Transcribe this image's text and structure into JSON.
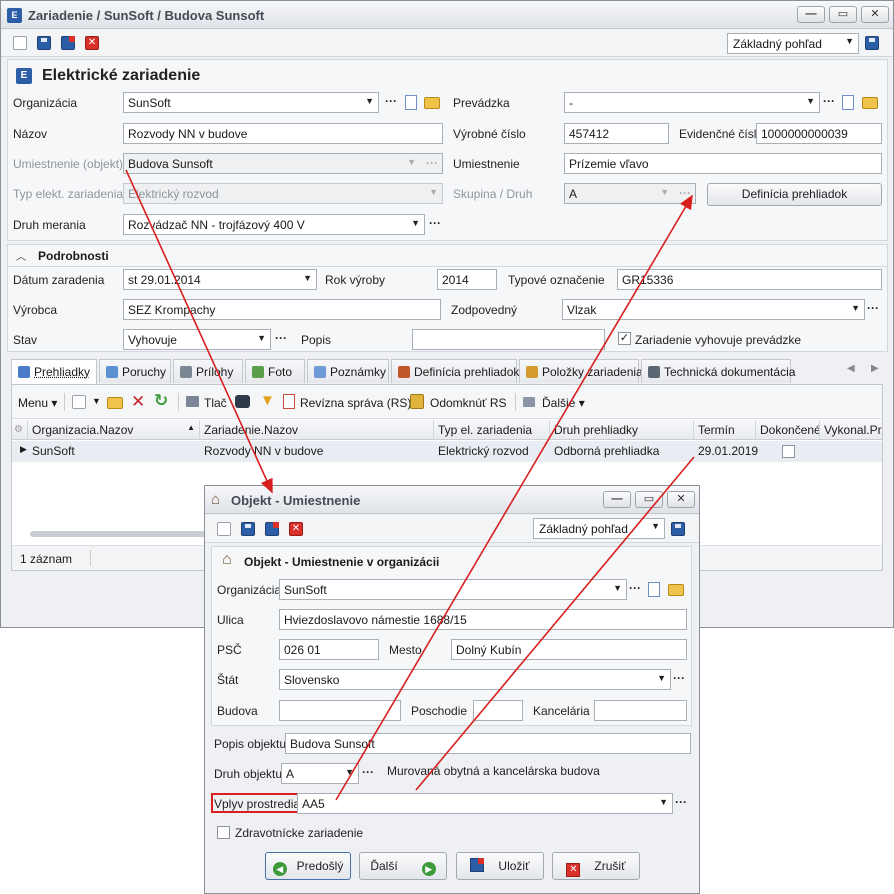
{
  "main_window": {
    "title": "Zariadenie / SunSoft / Budova Sunsoft",
    "view_select": "Základný pohľad",
    "header": "Elektrické zariadenie",
    "fields": {
      "organizacia_label": "Organizácia",
      "organizacia_value": "SunSoft",
      "prevadzka_label": "Prevádzka",
      "prevadzka_value": "-",
      "nazov_label": "Názov",
      "nazov_value": "Rozvody NN v budove",
      "vyrobne_cislo_label": "Výrobné číslo",
      "vyrobne_cislo_value": "457412",
      "evidencne_cislo_label": "Evidenčné číslo",
      "evidencne_cislo_value": "1000000000039",
      "umiestnenie_objekt_label": "Umiestnenie (objekt)",
      "umiestnenie_objekt_value": "Budova Sunsoft",
      "umiestnenie_label": "Umiestnenie",
      "umiestnenie_value": "Prízemie vľavo",
      "typ_label": "Typ elekt. zariadenia",
      "typ_value": "Elektrický rozvod",
      "skupina_label": "Skupina / Druh",
      "skupina_value": "A",
      "definicia_button": "Definícia prehliadok",
      "druh_merania_label": "Druh merania",
      "druh_merania_value": "Rozvádzač NN - trojfázový 400 V"
    },
    "details": {
      "section_title": "Podrobnosti",
      "datum_label": "Dátum zaradenia",
      "datum_value": "st 29.01.2014",
      "rok_label": "Rok výroby",
      "rok_value": "2014",
      "typove_label": "Typové označenie",
      "typove_value": "GR15336",
      "vyrobca_label": "Výrobca",
      "vyrobca_value": "SEZ Krompachy",
      "zodpovedny_label": "Zodpovedný",
      "zodpovedny_value": "Vlzak",
      "stav_label": "Stav",
      "stav_value": "Vyhovuje",
      "popis_label": "Popis",
      "popis_value": "",
      "vyhovuje_checkbox": "Zariadenie vyhovuje prevádzke"
    },
    "tabs": [
      {
        "label": "Prehliadky",
        "color": "#4a7bc8"
      },
      {
        "label": "Poruchy",
        "color": "#5a8fd1"
      },
      {
        "label": "Prílohy",
        "color": "#7d8694"
      },
      {
        "label": "Foto",
        "color": "#5aa04a"
      },
      {
        "label": "Poznámky",
        "color": "#6f9bd6"
      },
      {
        "label": "Definícia prehliadok",
        "color": "#c2562b"
      },
      {
        "label": "Položky zariadenia",
        "color": "#d49a2d"
      },
      {
        "label": "Technická dokumentácia",
        "color": "#5c6774"
      }
    ],
    "grid_toolbar": {
      "menu": "Menu",
      "tlac": "Tlač",
      "revizna": "Revízna správa (RS)",
      "odomknut": "Odomknúť RS",
      "dalsie": "Ďalšie"
    },
    "grid": {
      "columns": [
        "Organizacia.Nazov",
        "Zariadenie.Nazov",
        "Typ el. zariadenia",
        "Druh prehliadky",
        "Termín",
        "Dokončené",
        "Vykonal.Prie"
      ],
      "rows": [
        {
          "organizacia": "SunSoft",
          "zariadenie": "Rozvody NN v budove",
          "typ": "Elektrický rozvod",
          "druh": "Odborná prehliadka",
          "termin": "29.01.2019",
          "dokoncene": false
        }
      ],
      "status": "1 záznam"
    }
  },
  "dialog": {
    "title": "Objekt - Umiestnenie",
    "view_select": "Základný pohľad",
    "header": "Objekt - Umiestnenie v organizácii",
    "organizacia_label": "Organizácia",
    "organizacia_value": "SunSoft",
    "ulica_label": "Ulica",
    "ulica_value": "Hviezdoslavovo námestie 1688/15",
    "psc_label": "PSČ",
    "psc_value": "026 01",
    "mesto_label": "Mesto",
    "mesto_value": "Dolný Kubín",
    "stat_label": "Štát",
    "stat_value": "Slovensko",
    "budova_label": "Budova",
    "budova_value": "",
    "poschodie_label": "Poschodie",
    "poschodie_value": "",
    "kancelaria_label": "Kancelária",
    "kancelaria_value": "",
    "popis_label": "Popis objektu",
    "popis_value": "Budova Sunsoft",
    "druh_label": "Druh objektu",
    "druh_value": "A",
    "druh_desc": "Murovaná obytná a kancelárska budova",
    "vplyv_label": "Vplyv prostredia",
    "vplyv_value": "AA5",
    "zdravotnicke_checkbox": "Zdravotnícke zariadenie",
    "buttons": {
      "predosly": "Predošlý",
      "dalsi": "Ďalší",
      "ulozit": "Uložiť",
      "zrusit": "Zrušiť"
    }
  },
  "colors": {
    "annotation_red": "#d81f1f",
    "accent_blue": "#2b5ea7"
  }
}
